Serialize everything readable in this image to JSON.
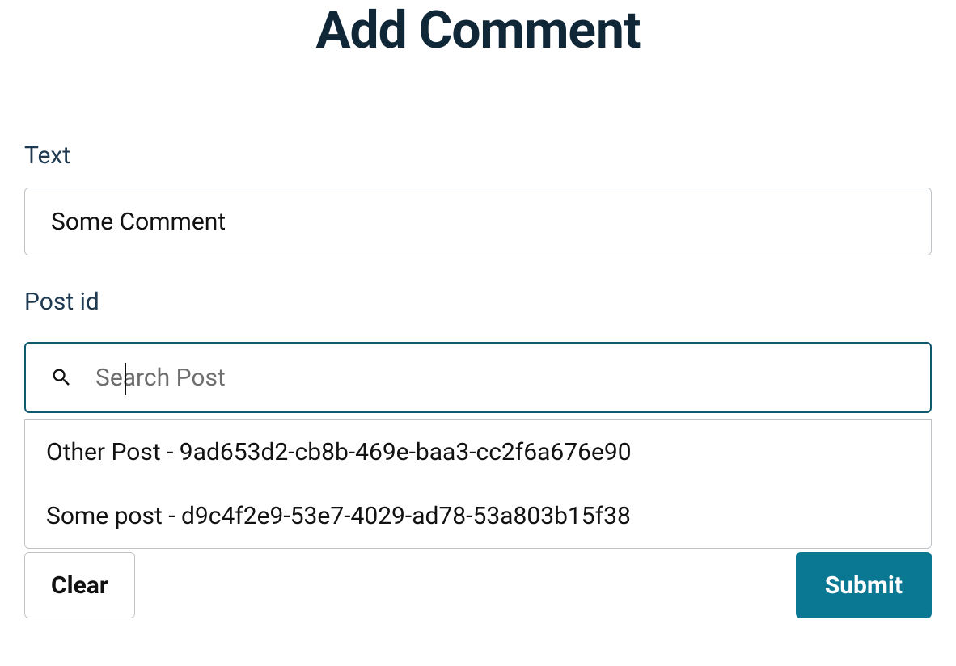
{
  "page": {
    "title": "Add Comment"
  },
  "form": {
    "text": {
      "label": "Text",
      "value": "Some Comment"
    },
    "post_id": {
      "label": "Post id",
      "placeholder": "Search Post",
      "value": ""
    }
  },
  "dropdown": {
    "items": [
      "Other Post - 9ad653d2-cb8b-469e-baa3-cc2f6a676e90",
      "Some post - d9c4f2e9-53e7-4029-ad78-53a803b15f38"
    ]
  },
  "buttons": {
    "clear": "Clear",
    "submit": "Submit"
  }
}
